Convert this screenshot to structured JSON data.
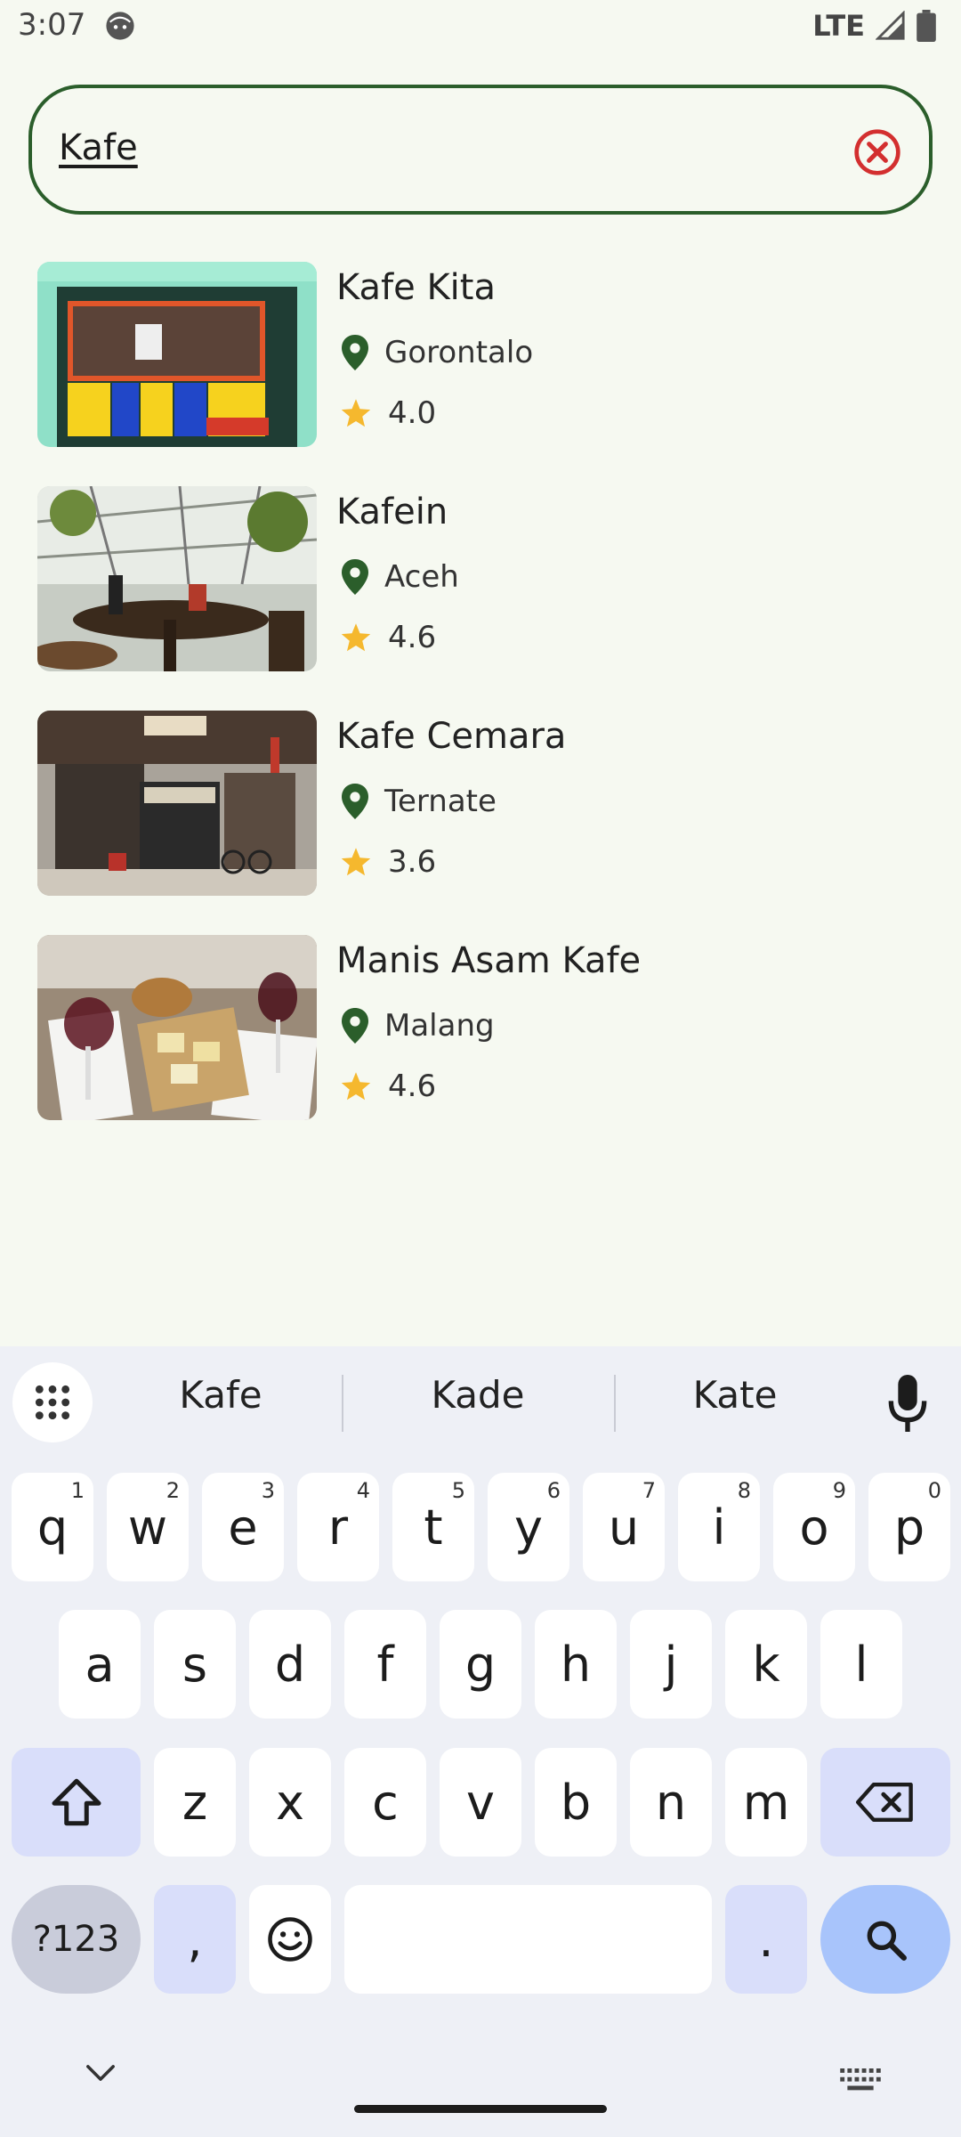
{
  "status_bar": {
    "time": "3:07",
    "network": "LTE"
  },
  "search": {
    "value": "Kafe"
  },
  "results": [
    {
      "name": "Kafe Kita",
      "location": "Gorontalo",
      "rating": "4.0"
    },
    {
      "name": "Kafein",
      "location": "Aceh",
      "rating": "4.6"
    },
    {
      "name": "Kafe Cemara",
      "location": "Ternate",
      "rating": "3.6"
    },
    {
      "name": "Manis Asam Kafe",
      "location": "Malang",
      "rating": "4.6"
    }
  ],
  "keyboard": {
    "suggestions": [
      "Kafe",
      "Kade",
      "Kate"
    ],
    "row1": [
      "q",
      "w",
      "e",
      "r",
      "t",
      "y",
      "u",
      "i",
      "o",
      "p"
    ],
    "row1_hints": [
      "1",
      "2",
      "3",
      "4",
      "5",
      "6",
      "7",
      "8",
      "9",
      "0"
    ],
    "row2": [
      "a",
      "s",
      "d",
      "f",
      "g",
      "h",
      "j",
      "k",
      "l"
    ],
    "row3": [
      "z",
      "x",
      "c",
      "v",
      "b",
      "n",
      "m"
    ],
    "symbols_label": "?123",
    "comma": ",",
    "period": "."
  },
  "colors": {
    "background": "#f6f9f1",
    "accent_green": "#2b5e2b",
    "star": "#f5b82e",
    "clear_red": "#d32f2f",
    "keyboard_bg": "#eef0f6"
  },
  "icons": [
    "face-icon",
    "signal-icon",
    "battery-icon",
    "clear-icon",
    "location-pin-icon",
    "star-icon",
    "apps-grid-icon",
    "mic-icon",
    "shift-icon",
    "backspace-icon",
    "emoji-icon",
    "search-icon",
    "chevron-down-icon",
    "keyboard-icon"
  ]
}
